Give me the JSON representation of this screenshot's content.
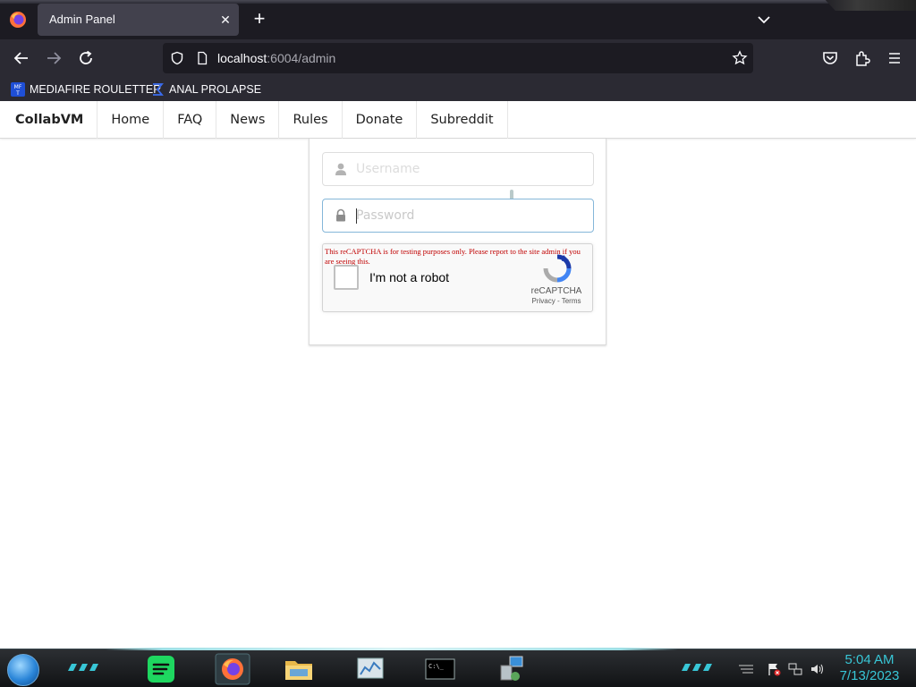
{
  "browser": {
    "tab_title": "Admin Panel",
    "url_host": "localhost",
    "url_path": ":6004/admin",
    "bookmarks": [
      {
        "label": "MEDIAFIRE ROULETTER",
        "icon": "mediafire-icon"
      },
      {
        "label": "ANAL PROLAPSE",
        "icon": "sigma-icon"
      }
    ]
  },
  "site_nav": {
    "brand": "CollabVM",
    "items": [
      "Home",
      "FAQ",
      "News",
      "Rules",
      "Donate",
      "Subreddit"
    ]
  },
  "login": {
    "username_placeholder": "Username",
    "password_placeholder": "Password"
  },
  "captcha": {
    "warning": "This reCAPTCHA is for testing purposes only. Please report to the site admin if you are seeing this.",
    "checkbox_label": "I'm not a robot",
    "brand": "reCAPTCHA",
    "links": "Privacy - Terms"
  },
  "taskbar": {
    "time": "5:04 AM",
    "date": "7/13/2023",
    "accent": "#38c6d6"
  }
}
